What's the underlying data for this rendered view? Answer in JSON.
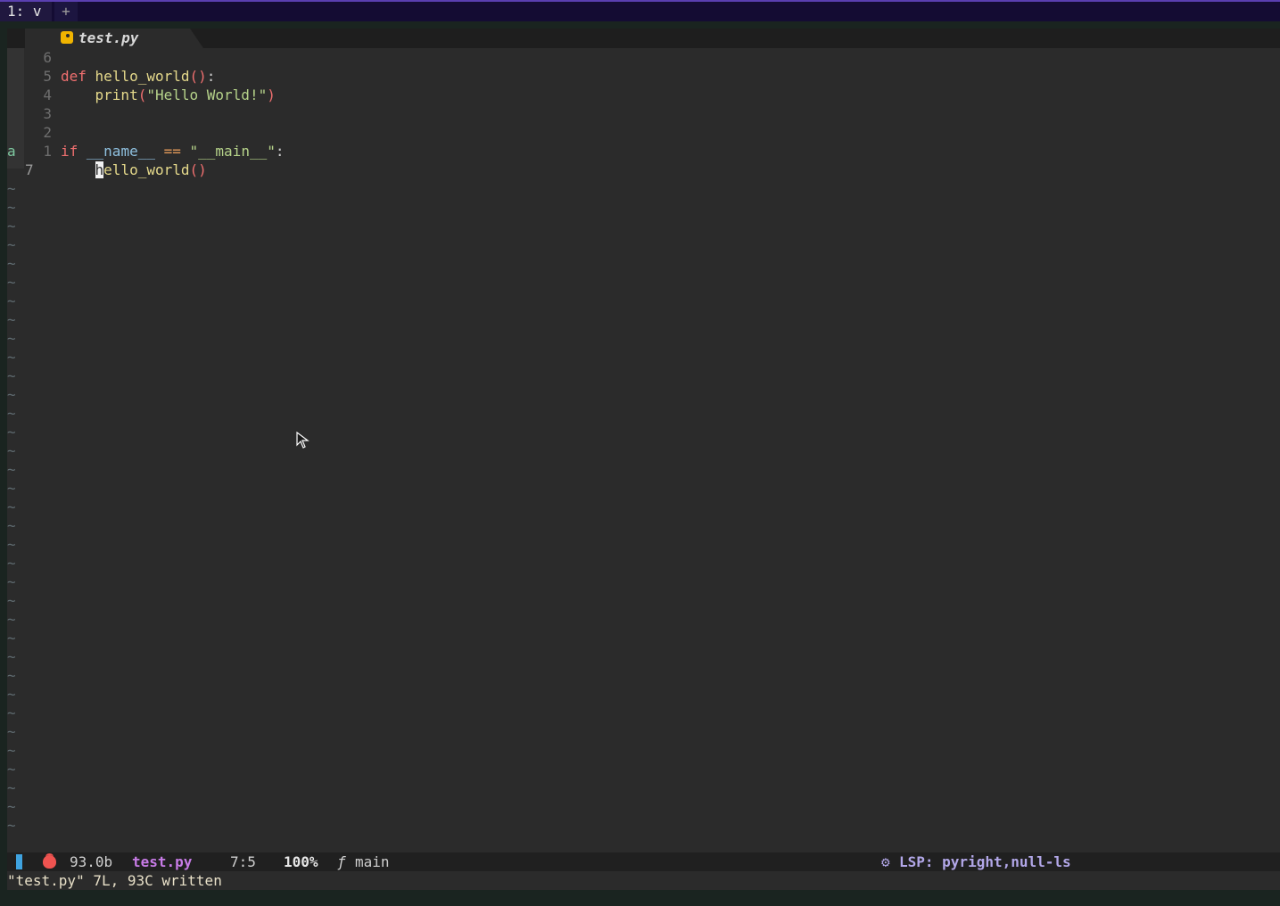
{
  "tmux": {
    "window_label": "1: v",
    "new_window_label": "+"
  },
  "bufferline": {
    "tab_icon": "python-icon",
    "tab_name": "test.py"
  },
  "editor": {
    "lines": [
      {
        "gutter": "6",
        "sign": "",
        "tokens": []
      },
      {
        "gutter": "5",
        "sign": "",
        "tokens": [
          {
            "t": "def",
            "c": "kw"
          },
          {
            "t": " "
          },
          {
            "t": "hello_world",
            "c": "fn"
          },
          {
            "t": "()",
            "c": "paren"
          },
          {
            "t": ":",
            "c": "punc"
          }
        ]
      },
      {
        "gutter": "4",
        "sign": "",
        "tokens": [
          {
            "t": "    "
          },
          {
            "t": "print",
            "c": "fn"
          },
          {
            "t": "(",
            "c": "paren"
          },
          {
            "t": "\"Hello World!\"",
            "c": "str"
          },
          {
            "t": ")",
            "c": "paren"
          }
        ]
      },
      {
        "gutter": "3",
        "sign": "",
        "tokens": []
      },
      {
        "gutter": "2",
        "sign": "",
        "tokens": []
      },
      {
        "gutter": "1",
        "sign": "a",
        "tokens": [
          {
            "t": "if",
            "c": "kw"
          },
          {
            "t": " "
          },
          {
            "t": "__name__",
            "c": "var"
          },
          {
            "t": " "
          },
          {
            "t": "==",
            "c": "op"
          },
          {
            "t": " "
          },
          {
            "t": "\"__main__\"",
            "c": "str"
          },
          {
            "t": ":",
            "c": "punc"
          }
        ]
      },
      {
        "gutter": "7",
        "sign": "",
        "current": true,
        "tokens": [
          {
            "t": "    "
          },
          {
            "t": "h",
            "c": "cursor"
          },
          {
            "t": "ello_world",
            "c": "fn"
          },
          {
            "t": "()",
            "c": "paren"
          }
        ]
      }
    ],
    "tilde_count": 37,
    "tilde_char": "~"
  },
  "statusline": {
    "file_size": "93.0b",
    "file_name": "test.py",
    "position": "7:5",
    "percent": "100%",
    "branch_icon": "ƒ",
    "branch": "main",
    "lsp_label": "LSP: pyright,null-ls"
  },
  "cmdline": {
    "message": "\"test.py\" 7L, 93C written"
  },
  "colors": {
    "accent_mode": "#3fa3e0",
    "filename": "#c77be6",
    "lsp": "#b2a7e8"
  }
}
